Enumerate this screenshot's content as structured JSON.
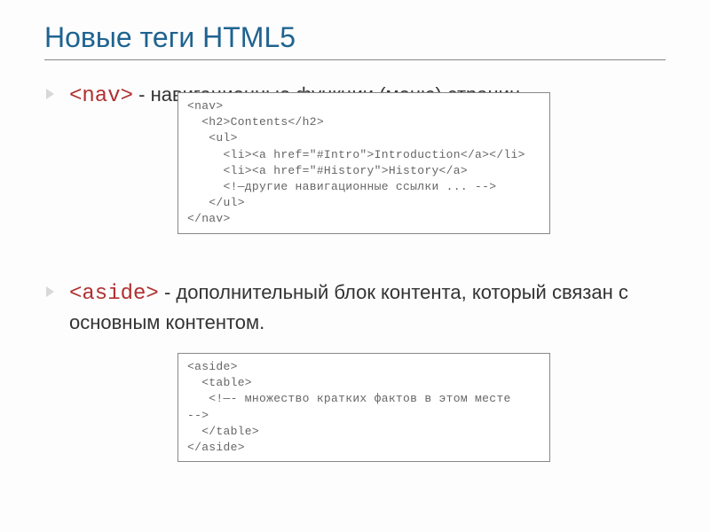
{
  "title": "Новые теги HTML5",
  "bullets": {
    "nav": {
      "tag": "<nav>",
      "desc": " - навигационные функции (меню) страниц"
    },
    "aside": {
      "tag": "<aside>",
      "desc": " - дополнительный блок контента, который связан с основным контентом."
    }
  },
  "code": {
    "nav": "<nav>\n  <h2>Contents</h2>\n   <ul>\n     <li><a href=\"#Intro\">Introduction</a></li>\n     <li><a href=\"#History\">History</a>\n     <!—другие навигационные ссылки ... -->\n   </ul>\n</nav>",
    "aside": "<aside>\n  <table>\n   <!—- множество кратких фактов в этом месте\n-->\n  </table>\n</aside>"
  }
}
